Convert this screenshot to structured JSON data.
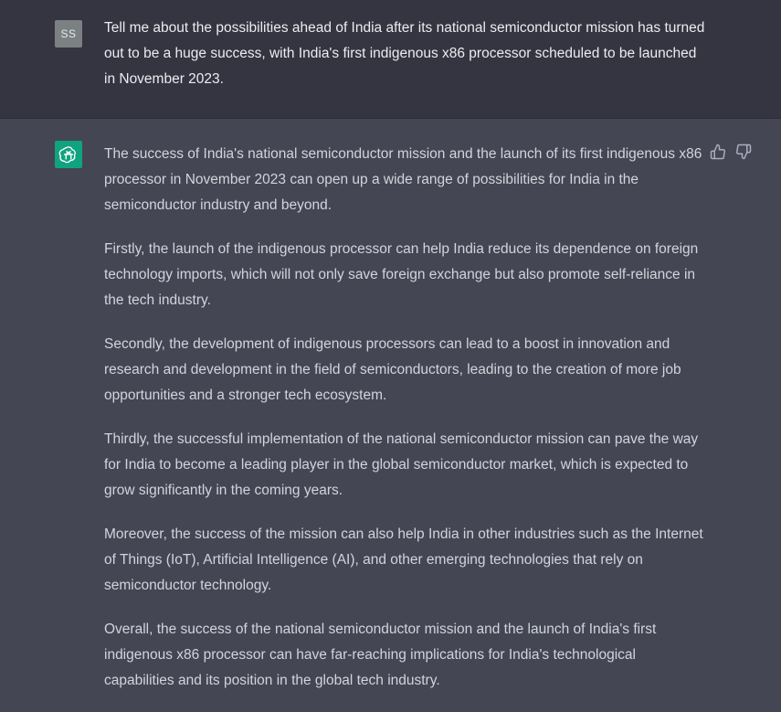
{
  "user": {
    "avatar_initials": "SS",
    "message": "Tell me about the possibilities ahead of India after its national semiconductor mission has turned out to be a huge success, with India's first indigenous x86 processor scheduled to be launched in November 2023."
  },
  "assistant": {
    "paragraphs": [
      "The success of India's national semiconductor mission and the launch of its first indigenous x86 processor in November 2023 can open up a wide range of possibilities for India in the semiconductor industry and beyond.",
      "Firstly, the launch of the indigenous processor can help India reduce its dependence on foreign technology imports, which will not only save foreign exchange but also promote self-reliance in the tech industry.",
      "Secondly, the development of indigenous processors can lead to a boost in innovation and research and development in the field of semiconductors, leading to the creation of more job opportunities and a stronger tech ecosystem.",
      "Thirdly, the successful implementation of the national semiconductor mission can pave the way for India to become a leading player in the global semiconductor market, which is expected to grow significantly in the coming years.",
      "Moreover, the success of the mission can also help India in other industries such as the Internet of Things (IoT), Artificial Intelligence (AI), and other emerging technologies that rely on semiconductor technology.",
      "Overall, the success of the national semiconductor mission and the launch of India's first indigenous x86 processor can have far-reaching implications for India's technological capabilities and its position in the global tech industry."
    ]
  },
  "icons": {
    "bot_avatar": "openai-logo-icon",
    "thumbs_up": "thumbs-up-icon",
    "thumbs_down": "thumbs-down-icon"
  },
  "colors": {
    "user_bg": "#343541",
    "assistant_bg": "#444654",
    "bot_avatar_bg": "#10a37f",
    "user_avatar_bg": "#7b8183"
  }
}
